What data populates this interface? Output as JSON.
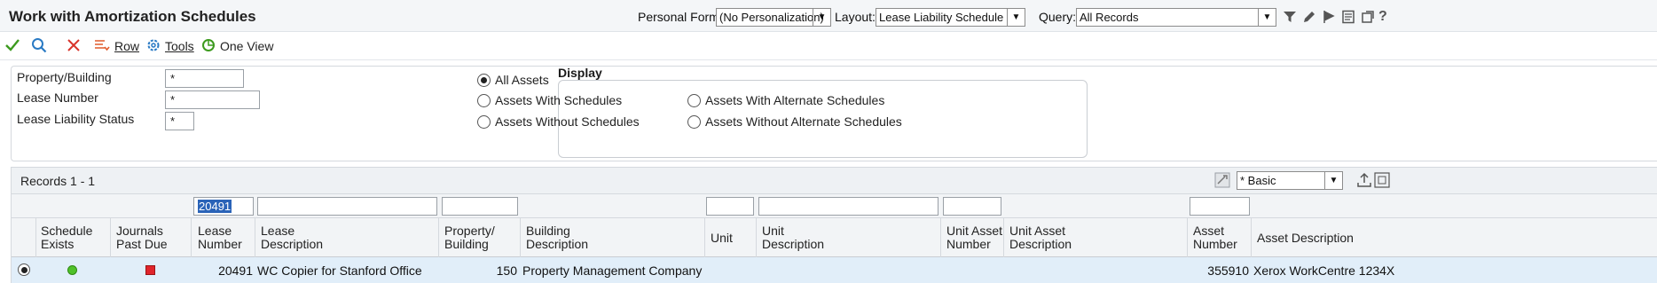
{
  "header": {
    "title": "Work with Amortization Schedules",
    "personal_form_label": "Personal Form:",
    "personal_form_value": "(No Personalization)",
    "layout_label": "Layout:",
    "layout_value": "Lease Liability Schedule",
    "query_label": "Query:",
    "query_value": "All Records",
    "icons": [
      "filter-icon",
      "edit-icon",
      "flag-icon",
      "report-icon",
      "new-window-icon",
      "help-icon"
    ]
  },
  "toolbar": {
    "ok_icon": "checkmark-icon",
    "find_icon": "search-icon",
    "close_icon": "close-icon",
    "row_label": "Row",
    "tools_label": "Tools",
    "one_view_label": "One View"
  },
  "filters": {
    "property_label": "Property/Building",
    "property_value": "*",
    "lease_number_label": "Lease Number",
    "lease_number_value": "*",
    "status_label": "Lease Liability Status",
    "status_value": "*"
  },
  "display": {
    "title": "Display",
    "options": [
      "All Assets",
      "Assets With Schedules",
      "Assets Without Schedules",
      "Assets With Alternate Schedules",
      "Assets Without Alternate Schedules"
    ],
    "selected": "All Assets"
  },
  "grid": {
    "records_label": "Records 1 - 1",
    "format_value": "* Basic",
    "qbe_lease_number": "20491",
    "columns": [
      {
        "l1": "Schedule",
        "l2": "Exists"
      },
      {
        "l1": "Journals",
        "l2": "Past Due"
      },
      {
        "l1": "Lease",
        "l2": "Number"
      },
      {
        "l1": "Lease",
        "l2": "Description"
      },
      {
        "l1": "Property/",
        "l2": "Building"
      },
      {
        "l1": "Building",
        "l2": "Description"
      },
      {
        "l1": "Unit",
        "l2": ""
      },
      {
        "l1": "Unit",
        "l2": "Description"
      },
      {
        "l1": "Unit Asset",
        "l2": "Number"
      },
      {
        "l1": "Unit Asset",
        "l2": "Description"
      },
      {
        "l1": "Asset",
        "l2": "Number"
      },
      {
        "l1": "Asset Description",
        "l2": ""
      }
    ],
    "rows": [
      {
        "schedule_exists": "green",
        "journals_past_due": "red",
        "lease_number": "20491",
        "lease_description": "WC Copier for Stanford Office",
        "property": "150",
        "building_description": "Property Management Company",
        "asset_number": "355910",
        "asset_description": "Xerox WorkCentre 1234X"
      }
    ],
    "status_colors": {
      "green": "#4fc12a",
      "red": "#e0242b"
    }
  }
}
